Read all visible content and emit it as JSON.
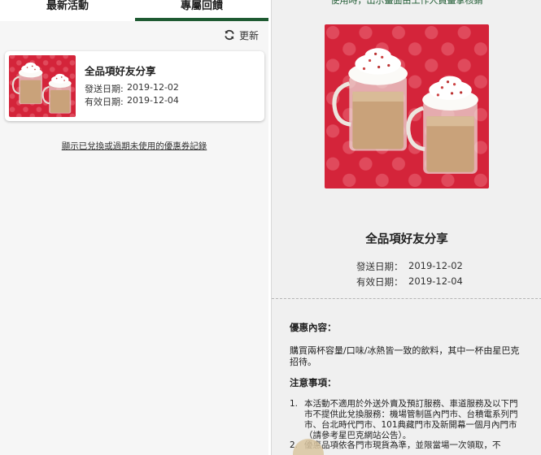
{
  "tabs": [
    {
      "label": "最新活動",
      "active": false
    },
    {
      "label": "專屬回饋",
      "active": true
    }
  ],
  "refresh_label": "更新",
  "coupon_card": {
    "title": "全品項好友分享",
    "send_label": "發送日期:",
    "send_date": "2019-12-02",
    "valid_label": "有效日期:",
    "valid_date": "2019-12-04"
  },
  "history_link": "顯示已兌換或過期未使用的優惠券記錄",
  "detail": {
    "top_text_cut": "使用時，出示畫面由工作人員畫掌核銷",
    "title": "全品項好友分享",
    "send_label": "發送日期：",
    "send_date": "2019-12-02",
    "valid_label": "有效日期：",
    "valid_date": "2019-12-04",
    "offer_heading": "優惠內容：",
    "offer_text": "購買兩杯容量/口味/冰熱皆一致的飲料，其中一杯由星巴克招待。",
    "notes_heading": "注意事項：",
    "notes": [
      {
        "num": "1.",
        "text": "本活動不適用於外送外賣及預訂服務、車道服務及以下門市不提供此兌換服務：機場管制區內門市、台積電系列門市、台北時代門市、101典藏門市及新開幕一個月內門市（請參考星巴克網站公告）。"
      },
      {
        "num": "2.",
        "text": "優惠品項依各門市現貨為準，並限當場一次領取，不"
      }
    ]
  },
  "colors": {
    "brand_green": "#1e5a32",
    "promo_red": "#d4243a"
  }
}
